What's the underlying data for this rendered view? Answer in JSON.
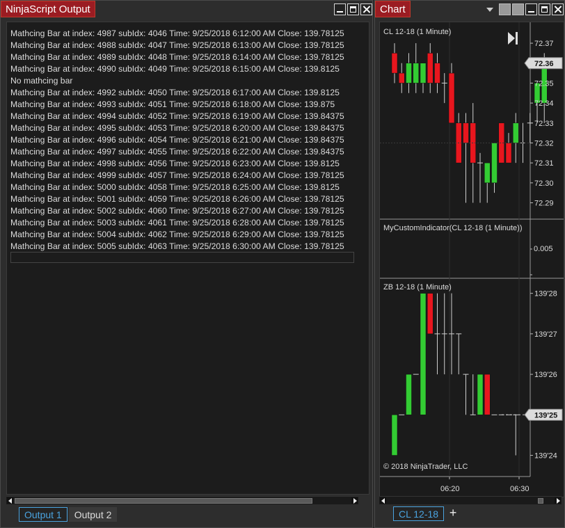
{
  "output_window": {
    "title": "NinjaScript Output",
    "lines": [
      "Mathcing Bar at index: 4987 subIdx: 4046 Time: 9/25/2018 6:12:00 AM Close: 139.78125",
      "Mathcing Bar at index: 4988 subIdx: 4047 Time: 9/25/2018 6:13:00 AM Close: 139.78125",
      "Mathcing Bar at index: 4989 subIdx: 4048 Time: 9/25/2018 6:14:00 AM Close: 139.78125",
      "Mathcing Bar at index: 4990 subIdx: 4049 Time: 9/25/2018 6:15:00 AM Close: 139.8125",
      "No mathcing bar",
      "Mathcing Bar at index: 4992 subIdx: 4050 Time: 9/25/2018 6:17:00 AM Close: 139.8125",
      "Mathcing Bar at index: 4993 subIdx: 4051 Time: 9/25/2018 6:18:00 AM Close: 139.875",
      "Mathcing Bar at index: 4994 subIdx: 4052 Time: 9/25/2018 6:19:00 AM Close: 139.84375",
      "Mathcing Bar at index: 4995 subIdx: 4053 Time: 9/25/2018 6:20:00 AM Close: 139.84375",
      "Mathcing Bar at index: 4996 subIdx: 4054 Time: 9/25/2018 6:21:00 AM Close: 139.84375",
      "Mathcing Bar at index: 4997 subIdx: 4055 Time: 9/25/2018 6:22:00 AM Close: 139.84375",
      "Mathcing Bar at index: 4998 subIdx: 4056 Time: 9/25/2018 6:23:00 AM Close: 139.8125",
      "Mathcing Bar at index: 4999 subIdx: 4057 Time: 9/25/2018 6:24:00 AM Close: 139.78125",
      "Mathcing Bar at index: 5000 subIdx: 4058 Time: 9/25/2018 6:25:00 AM Close: 139.8125",
      "Mathcing Bar at index: 5001 subIdx: 4059 Time: 9/25/2018 6:26:00 AM Close: 139.78125",
      "Mathcing Bar at index: 5002 subIdx: 4060 Time: 9/25/2018 6:27:00 AM Close: 139.78125",
      "Mathcing Bar at index: 5003 subIdx: 4061 Time: 9/25/2018 6:28:00 AM Close: 139.78125",
      "Mathcing Bar at index: 5004 subIdx: 4062 Time: 9/25/2018 6:29:00 AM Close: 139.78125",
      "Mathcing Bar at index: 5005 subIdx: 4063 Time: 9/25/2018 6:30:00 AM Close: 139.78125"
    ],
    "tabs": [
      {
        "label": "Output 1",
        "active": true
      },
      {
        "label": "Output 2",
        "active": false
      }
    ]
  },
  "chart_window": {
    "title": "Chart",
    "tab_label": "CL 12-18",
    "add_tab_symbol": "+",
    "copyright": "© 2018 NinjaTrader, LLC"
  },
  "colors": {
    "up": "#33cc33",
    "down": "#e8161e",
    "title_tab": "#9b1c22",
    "active_tab": "#4aa3df"
  },
  "chart_data": [
    {
      "type": "candlestick",
      "title": "CL 12-18 (1 Minute)",
      "y_ticks": [
        "72.37",
        "72.36",
        "72.35",
        "72.34",
        "72.33",
        "72.32",
        "72.31",
        "72.30",
        "72.29"
      ],
      "ylim": [
        72.286,
        72.377
      ],
      "last_price": "72.36",
      "bars": [
        {
          "o": 72.365,
          "h": 72.37,
          "l": 72.35,
          "c": 72.355
        },
        {
          "o": 72.355,
          "h": 72.36,
          "l": 72.345,
          "c": 72.35
        },
        {
          "o": 72.35,
          "h": 72.365,
          "l": 72.345,
          "c": 72.36
        },
        {
          "o": 72.35,
          "h": 72.37,
          "l": 72.345,
          "c": 72.36
        },
        {
          "o": 72.35,
          "h": 72.36,
          "l": 72.345,
          "c": 72.36
        },
        {
          "o": 72.365,
          "h": 72.37,
          "l": 72.345,
          "c": 72.35
        },
        {
          "o": 72.36,
          "h": 72.365,
          "l": 72.345,
          "c": 72.35
        },
        {
          "o": 72.35,
          "h": 72.355,
          "l": 72.34,
          "c": 72.35
        },
        {
          "o": 72.355,
          "h": 72.36,
          "l": 72.33,
          "c": 72.33
        },
        {
          "o": 72.33,
          "h": 72.335,
          "l": 72.31,
          "c": 72.31
        },
        {
          "o": 72.33,
          "h": 72.335,
          "l": 72.29,
          "c": 72.32
        },
        {
          "o": 72.33,
          "h": 72.34,
          "l": 72.29,
          "c": 72.31
        },
        {
          "o": 72.31,
          "h": 72.315,
          "l": 72.29,
          "c": 72.31
        },
        {
          "o": 72.3,
          "h": 72.31,
          "l": 72.29,
          "c": 72.31
        },
        {
          "o": 72.3,
          "h": 72.32,
          "l": 72.295,
          "c": 72.32
        },
        {
          "o": 72.33,
          "h": 72.33,
          "l": 72.31,
          "c": 72.31
        },
        {
          "o": 72.32,
          "h": 72.325,
          "l": 72.31,
          "c": 72.31
        },
        {
          "o": 72.32,
          "h": 72.335,
          "l": 72.31,
          "c": 72.33
        },
        {
          "o": 72.32,
          "h": 72.33,
          "l": 72.31,
          "c": 72.32
        },
        {
          "o": 72.33,
          "h": 72.335,
          "l": 72.32,
          "c": 72.33
        },
        {
          "o": 72.34,
          "h": 72.35,
          "l": 72.33,
          "c": 72.35
        },
        {
          "o": 72.34,
          "h": 72.365,
          "l": 72.33,
          "c": 72.36
        }
      ]
    },
    {
      "type": "line",
      "title": "MyCustomIndicator(CL 12-18 (1 Minute))",
      "y_ticks": [
        "0.005"
      ]
    },
    {
      "type": "candlestick",
      "title": "ZB 12-18 (1 Minute)",
      "y_ticks": [
        "139'28",
        "139'27",
        "139'26",
        "139'25",
        "139'24"
      ],
      "ylim": [
        23.7,
        28.2
      ],
      "last_price": "139'25",
      "x_ticks": [
        "06:20",
        "06:30"
      ],
      "bars": [
        {
          "o": 24.0,
          "h": 25.0,
          "l": 24.0,
          "c": 25.0
        },
        {
          "o": 25.0,
          "h": 25.0,
          "l": 25.0,
          "c": 25.0
        },
        {
          "o": 25.0,
          "h": 26.0,
          "l": 25.0,
          "c": 26.0
        },
        {
          "o": 26.0,
          "h": 26.0,
          "l": 26.0,
          "c": 26.0
        },
        {
          "o": 25.0,
          "h": 28.0,
          "l": 25.0,
          "c": 28.0
        },
        {
          "o": 28.0,
          "h": 28.0,
          "l": 27.0,
          "c": 27.0
        },
        {
          "o": 27.0,
          "h": 28.0,
          "l": 26.0,
          "c": 27.0
        },
        {
          "o": 27.0,
          "h": 28.0,
          "l": 26.0,
          "c": 27.0
        },
        {
          "o": 27.0,
          "h": 28.0,
          "l": 26.0,
          "c": 27.0
        },
        {
          "o": 27.0,
          "h": 27.0,
          "l": 26.0,
          "c": 27.0
        },
        {
          "o": 26.0,
          "h": 26.0,
          "l": 25.0,
          "c": 26.0
        },
        {
          "o": 25.0,
          "h": 26.0,
          "l": 25.0,
          "c": 25.0
        },
        {
          "o": 25.0,
          "h": 26.0,
          "l": 25.0,
          "c": 26.0
        },
        {
          "o": 26.0,
          "h": 26.0,
          "l": 25.0,
          "c": 25.0
        },
        {
          "o": 25.0,
          "h": 25.0,
          "l": 25.0,
          "c": 25.0
        },
        {
          "o": 25.0,
          "h": 25.0,
          "l": 25.0,
          "c": 25.0
        },
        {
          "o": 25.0,
          "h": 25.0,
          "l": 25.0,
          "c": 25.0
        },
        {
          "o": 25.0,
          "h": 25.0,
          "l": 24.0,
          "c": 25.0
        }
      ]
    }
  ]
}
